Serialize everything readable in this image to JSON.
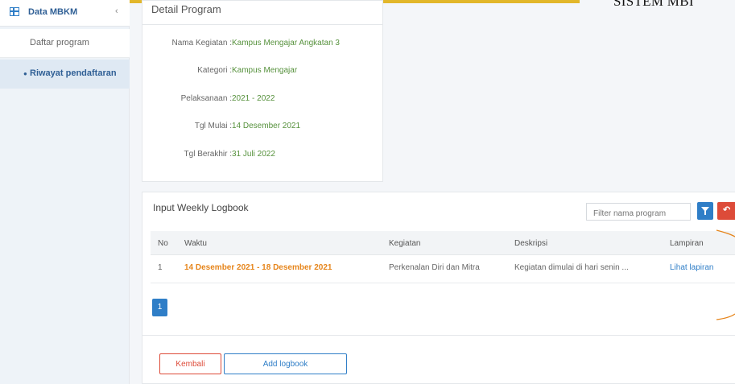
{
  "app": {
    "brand": "SISTEM MBI"
  },
  "sidebar": {
    "header": "Data MBKM",
    "items": [
      {
        "label": "Daftar program"
      },
      {
        "label": "Riwayat pendaftaran"
      }
    ]
  },
  "detail": {
    "title": "Detail Program",
    "rows": [
      {
        "label": "Nama Kegiatan :",
        "value": "Kampus Mengajar Angkatan 3"
      },
      {
        "label": "Kategori :",
        "value": "Kampus Mengajar"
      },
      {
        "label": "Pelaksanaan :",
        "value": "2021 - 2022"
      },
      {
        "label": "Tgl Mulai :",
        "value": "14 Desember 2021"
      },
      {
        "label": "Tgl Berakhir :",
        "value": "31 Juli 2022"
      }
    ]
  },
  "logbook": {
    "title": "Input Weekly Logbook",
    "filter_placeholder": "Filter nama program",
    "reset_glyph": "↶",
    "columns": [
      "No",
      "Waktu",
      "Kegiatan",
      "Deskripsi",
      "Lampiran"
    ],
    "rows": [
      {
        "no": "1",
        "waktu": "14 Desember 2021 - 18 Desember 2021",
        "kegiatan": "Perkenalan Diri dan Mitra",
        "deskripsi": "Kegiatan dimulai di hari senin ...",
        "lampiran": "Lihat lapiran"
      }
    ],
    "page": "1",
    "back_label": "Kembali",
    "add_label": "Add logbook"
  },
  "colors": {
    "accent_bar": "#e2b72b",
    "primary": "#2f7ec7",
    "danger": "#dd4b39",
    "value_green": "#56913c",
    "date_orange": "#e6851b"
  },
  "icons": [
    "grid-icon",
    "chevron-left-icon",
    "filter-icon",
    "undo-icon"
  ]
}
